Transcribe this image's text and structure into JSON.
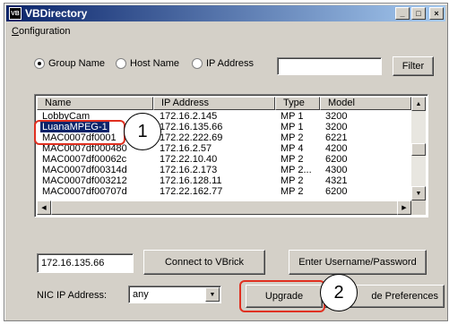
{
  "window": {
    "app_icon_text": "VB",
    "title": "VBDirectory",
    "minimize": "_",
    "maximize": "□",
    "close": "×"
  },
  "menu": {
    "configuration": "Configuration"
  },
  "filter_options": {
    "options": [
      "Group Name",
      "Host Name",
      "IP Address"
    ],
    "selected": "Group Name",
    "filter_value": "",
    "filter_button": "Filter"
  },
  "device_list": {
    "columns": [
      "Name",
      "IP Address",
      "Type",
      "Model"
    ],
    "rows": [
      {
        "name": "LobbyCam",
        "ip": "172.16.2.145",
        "type": "MP 1",
        "model": "3200"
      },
      {
        "name": "LuanaMPEG-1",
        "ip": "172.16.135.66",
        "type": "MP 1",
        "model": "3200",
        "selected": true
      },
      {
        "name": "MAC0007df0001",
        "ip": "172.22.222.69",
        "type": "MP 2",
        "model": "6221"
      },
      {
        "name": "MAC0007df000480",
        "ip": "172.16.2.57",
        "type": "MP 4",
        "model": "4200"
      },
      {
        "name": "MAC0007df00062c",
        "ip": "172.22.10.40",
        "type": "MP 2",
        "model": "6200"
      },
      {
        "name": "MAC0007df00314d",
        "ip": "172.16.2.173",
        "type": "MP 2...",
        "model": "4300"
      },
      {
        "name": "MAC0007df003212",
        "ip": "172.16.128.11",
        "type": "MP 2",
        "model": "4321"
      },
      {
        "name": "MAC0007df00707d",
        "ip": "172.22.162.77",
        "type": "MP 2",
        "model": "6200"
      }
    ],
    "scroll_up": "▲",
    "scroll_down": "▼",
    "scroll_left": "◀",
    "scroll_right": "▶"
  },
  "actions": {
    "ip_value": "172.16.135.66",
    "connect_button": "Connect to VBrick",
    "credentials_button": "Enter Username/Password",
    "nic_label": "NIC IP Address:",
    "nic_value": "any",
    "nic_drop": "▼",
    "upgrade_button": "Upgrade",
    "preferences_button": "de Preferences"
  },
  "callouts": {
    "one": "1",
    "two": "2"
  },
  "colors": {
    "title_bar": "#0a246a",
    "selection": "#0a246a",
    "callout_border": "#e03020",
    "window_face": "#d4d0c8"
  }
}
